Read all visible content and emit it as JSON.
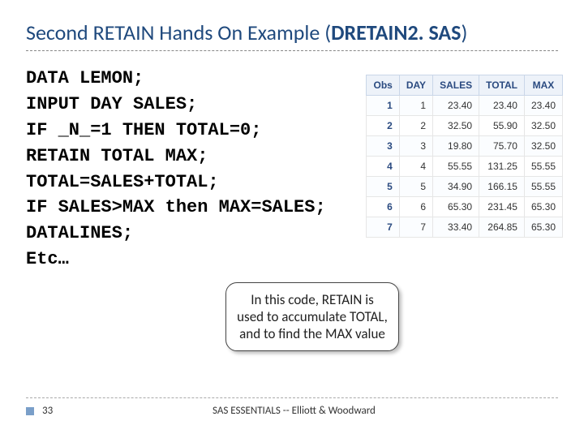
{
  "title": {
    "prefix": "Second RETAIN Hands On Example (",
    "bold": "DRETAIN2. SAS",
    "suffix": ")"
  },
  "code": {
    "l1": "DATA LEMON;",
    "l2": "INPUT DAY SALES;",
    "l3": "IF _N_=1 THEN TOTAL=0;",
    "l4": "RETAIN TOTAL MAX;",
    "l5": "TOTAL=SALES+TOTAL;",
    "l6": "IF SALES>MAX then MAX=SALES;",
    "l7": "DATALINES;",
    "l8": "Etc…"
  },
  "callout": "In this code, RETAIN is used to accumulate TOTAL, and to find the MAX value",
  "footer": {
    "page": "33",
    "credit": "SAS ESSENTIALS -- Elliott & Woodward"
  },
  "chart_data": {
    "type": "table",
    "columns": [
      "Obs",
      "DAY",
      "SALES",
      "TOTAL",
      "MAX"
    ],
    "rows": [
      [
        "1",
        "1",
        "23.40",
        "23.40",
        "23.40"
      ],
      [
        "2",
        "2",
        "32.50",
        "55.90",
        "32.50"
      ],
      [
        "3",
        "3",
        "19.80",
        "75.70",
        "32.50"
      ],
      [
        "4",
        "4",
        "55.55",
        "131.25",
        "55.55"
      ],
      [
        "5",
        "5",
        "34.90",
        "166.15",
        "55.55"
      ],
      [
        "6",
        "6",
        "65.30",
        "231.45",
        "65.30"
      ],
      [
        "7",
        "7",
        "33.40",
        "264.85",
        "65.30"
      ]
    ]
  }
}
